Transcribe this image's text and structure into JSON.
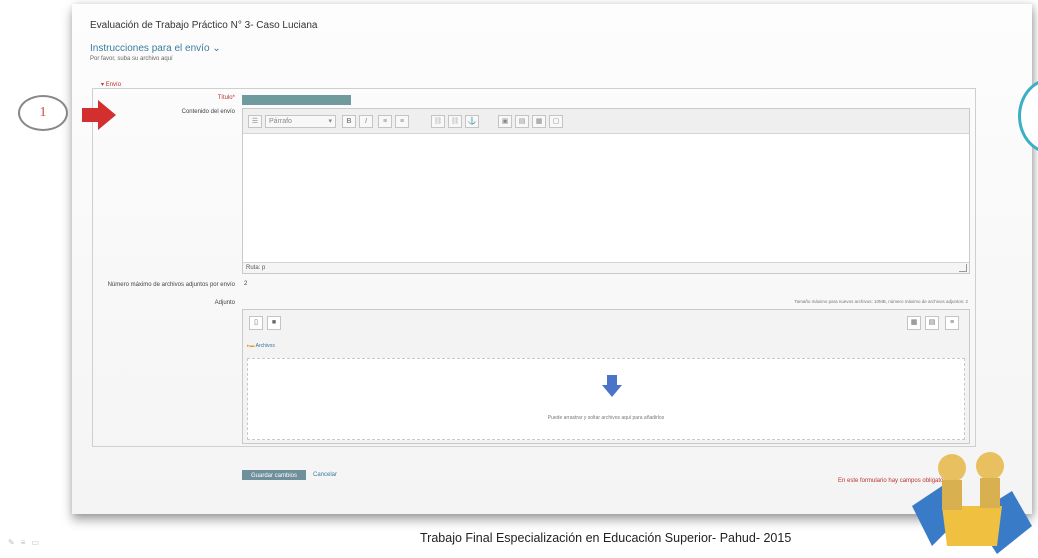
{
  "page": {
    "title": "Evaluación de Trabajo Práctico N° 3- Caso Luciana",
    "instructions_link": "Instrucciones para el envío",
    "instructions_sub": "Por favor, suba su archivo aquí"
  },
  "form": {
    "legend": "Envío",
    "title_label": "Título",
    "content_label": "Contenido del envío",
    "editor": {
      "format_value": "Párrafo",
      "path": "Ruta: p"
    },
    "max_files_label": "Número máximo de archivos adjuntos por envío",
    "max_files_value": "2",
    "attachment_label": "Adjunto",
    "filesize_note": "Tamaño máximo para nuevos archivos: 10MB, número máximo de archivos adjuntos: 2",
    "file_path": "Archivos",
    "drop_text": "Puede arrastrar y soltar archivos aquí para añadirlos",
    "save_label": "Guardar cambios",
    "cancel_label": "Cancelar",
    "required_note": "En este formulario hay campos obligatorios"
  },
  "annotation": {
    "step_number": "1"
  },
  "footer": {
    "text": "Trabajo Final Especialización en Educación Superior- Pahud- 2015"
  },
  "colors": {
    "link": "#3a7ca0",
    "required": "#b33333",
    "arrow": "#d32f2f",
    "accent_teal": "#3ab0c4",
    "drop_arrow": "#4a74c8"
  },
  "icons": [
    "paragraph-format-icon",
    "bold-icon",
    "italic-icon",
    "bullet-list-icon",
    "numbered-list-icon",
    "link-icon",
    "unlink-icon",
    "image-icon",
    "media-icon",
    "table-icon",
    "new-file-icon",
    "folder-icon",
    "grid-view-icon",
    "list-view-icon",
    "tree-view-icon",
    "download-arrow-icon"
  ]
}
